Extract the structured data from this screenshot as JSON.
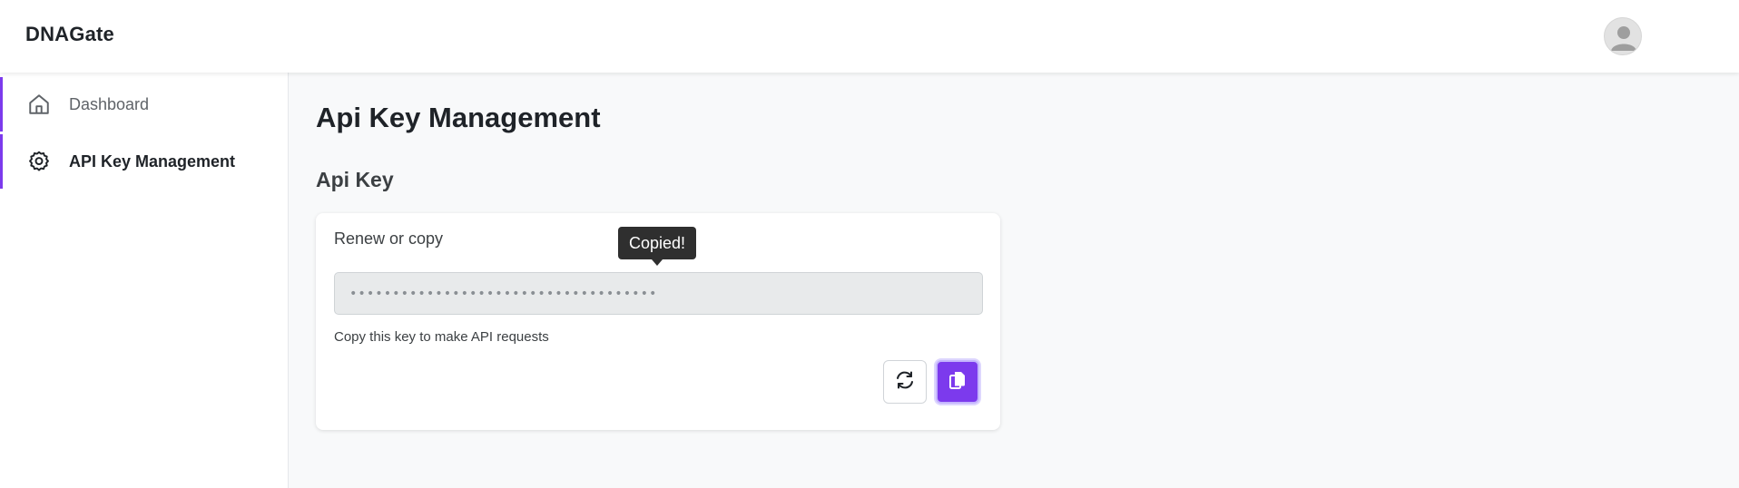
{
  "header": {
    "brand": "DNAGate",
    "avatar_icon": "user-avatar-icon"
  },
  "sidebar": {
    "items": [
      {
        "label": "Dashboard",
        "icon": "home-icon"
      },
      {
        "label": "API Key Management",
        "icon": "gear-icon",
        "active": true
      }
    ],
    "accent_color": "#7c3aed"
  },
  "main": {
    "page_title": "Api Key Management",
    "section_title": "Api Key",
    "card": {
      "title": "Renew or copy",
      "tooltip": "Copied!",
      "key_value": "••••••••••••••••••••••••••••••••••••",
      "helper_text": "Copy this key to make API requests",
      "renew_icon": "refresh-icon",
      "copy_icon": "copy-icon"
    }
  }
}
